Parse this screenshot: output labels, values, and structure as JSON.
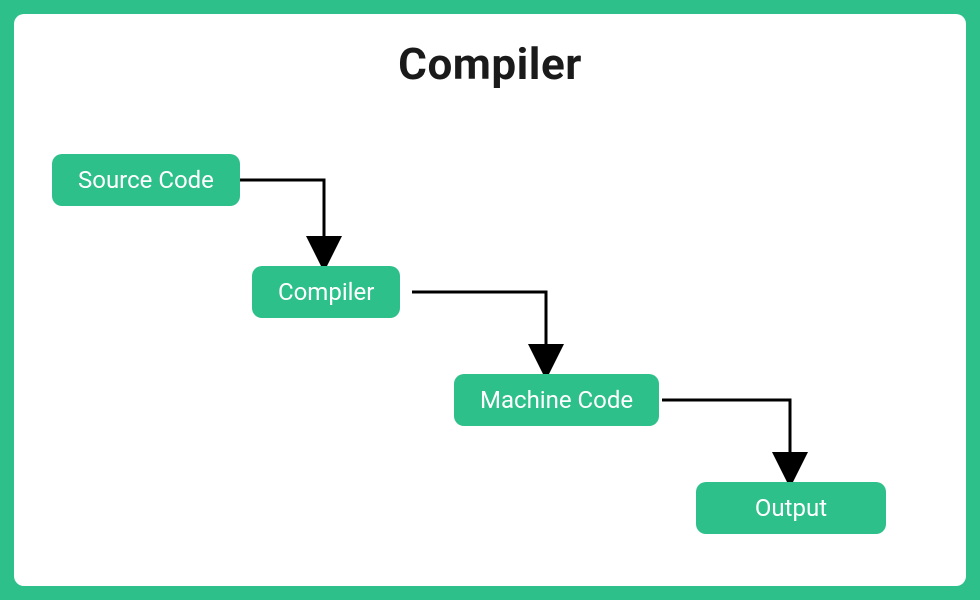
{
  "title": "Compiler",
  "nodes": {
    "source": {
      "label": "Source Code"
    },
    "compiler": {
      "label": "Compiler"
    },
    "machine": {
      "label": "Machine Code"
    },
    "output": {
      "label": "Output"
    }
  },
  "colors": {
    "accent": "#2ec08a",
    "background": "#ffffff",
    "text_on_accent": "#ffffff",
    "title_text": "#1a1a1a",
    "arrow": "#000000"
  }
}
